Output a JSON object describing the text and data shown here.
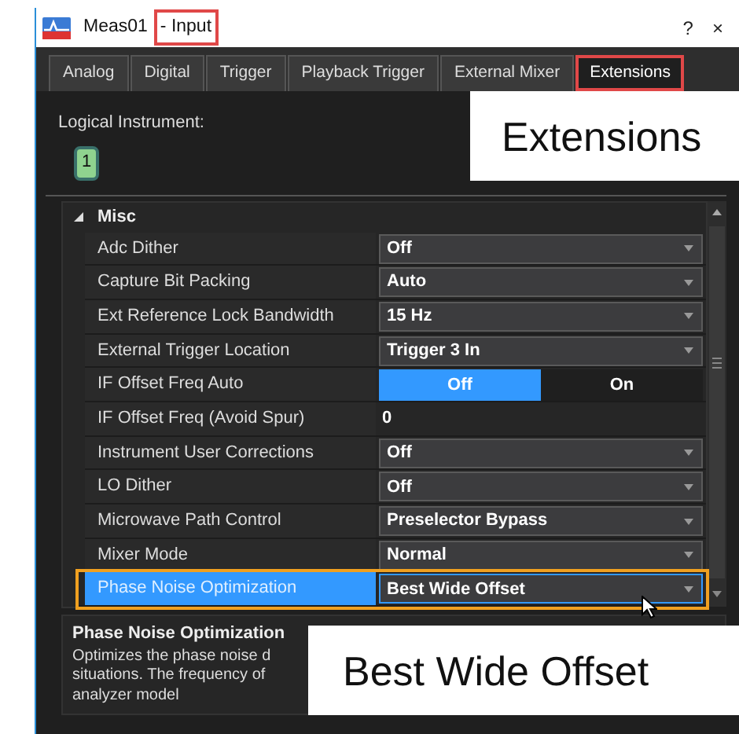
{
  "window": {
    "title_parts": [
      {
        "text": "Meas01",
        "marked": false
      },
      {
        "text": "- Input",
        "marked": true
      }
    ],
    "help_button": "?",
    "close_button": "×"
  },
  "tabs": [
    {
      "label": "Analog",
      "selected": false,
      "marked": false
    },
    {
      "label": "Digital",
      "selected": false,
      "marked": false
    },
    {
      "label": "Trigger",
      "selected": false,
      "marked": false
    },
    {
      "label": "Playback Trigger",
      "selected": false,
      "marked": false
    },
    {
      "label": "External Mixer",
      "selected": false,
      "marked": false
    },
    {
      "label": "Extensions",
      "selected": true,
      "marked": true
    }
  ],
  "logical_instrument": {
    "label": "Logical Instrument:",
    "buttons": [
      {
        "label": "1",
        "selected": true
      }
    ]
  },
  "property_grid": {
    "group": {
      "label": "Misc",
      "expanded": true
    },
    "rows": [
      {
        "kind": "dropdown",
        "label": "Adc Dither",
        "value": "Off",
        "selected": false,
        "marked": false
      },
      {
        "kind": "dropdown",
        "label": "Capture Bit Packing",
        "value": "Auto",
        "selected": false,
        "marked": false
      },
      {
        "kind": "dropdown",
        "label": "Ext Reference Lock Bandwidth",
        "value": "15 Hz",
        "selected": false,
        "marked": false
      },
      {
        "kind": "dropdown",
        "label": "External Trigger Location",
        "value": "Trigger 3 In",
        "selected": false,
        "marked": false
      },
      {
        "kind": "toggle",
        "label": "IF Offset Freq  Auto",
        "options": [
          {
            "label": "Off",
            "selected": true
          },
          {
            "label": "On",
            "selected": false
          }
        ],
        "selected": false,
        "marked": false
      },
      {
        "kind": "text",
        "label": "IF Offset Freq (Avoid Spur)",
        "value": "0",
        "selected": false,
        "marked": false
      },
      {
        "kind": "dropdown",
        "label": "Instrument User Corrections",
        "value": "Off",
        "selected": false,
        "marked": false
      },
      {
        "kind": "dropdown",
        "label": "LO Dither",
        "value": "Off",
        "selected": false,
        "marked": false
      },
      {
        "kind": "dropdown",
        "label": "Microwave Path Control",
        "value": "Preselector Bypass",
        "selected": false,
        "marked": false
      },
      {
        "kind": "dropdown",
        "label": "Mixer Mode",
        "value": "Normal",
        "selected": false,
        "marked": false
      },
      {
        "kind": "dropdown",
        "label": "Phase Noise Optimization",
        "value": "Best Wide Offset",
        "selected": true,
        "marked": true
      }
    ]
  },
  "help": {
    "title": "Phase Noise Optimization",
    "lines": [
      "Optimizes the phase noise d",
      "situations. The frequency of",
      "analyzer model"
    ]
  },
  "callouts": [
    {
      "text": "Extensions"
    },
    {
      "text": "Best Wide Offset"
    }
  ]
}
